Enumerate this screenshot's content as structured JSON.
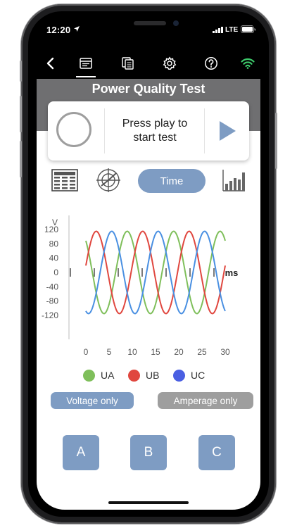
{
  "status_bar": {
    "time": "12:20",
    "network": "LTE"
  },
  "header": {
    "title": "Power Quality Test"
  },
  "test_card": {
    "message": "Press play to\nstart test"
  },
  "view_tabs": {
    "time_label": "Time"
  },
  "colors": {
    "accent": "#7e9cc3",
    "phase_a": "#7fbf5b",
    "phase_b": "#e0473f",
    "phase_c": "#4a90e2",
    "inactive": "#9e9e9e"
  },
  "chart_data": {
    "type": "line",
    "ylabel": "V",
    "xlabel": "ms",
    "x_ticks": [
      0,
      5,
      10,
      15,
      20,
      25,
      30
    ],
    "y_ticks": [
      120,
      80,
      40,
      0,
      -40,
      -80,
      -120
    ],
    "xlim": [
      0,
      30
    ],
    "ylim": [
      -120,
      120
    ],
    "series": [
      {
        "name": "UA",
        "amplitude": 115,
        "phase_deg": 0,
        "period_ms": 10
      },
      {
        "name": "UB",
        "amplitude": 115,
        "phase_deg": 120,
        "period_ms": 10
      },
      {
        "name": "UC",
        "amplitude": 115,
        "phase_deg": 240,
        "period_ms": 10
      }
    ]
  },
  "legend": [
    {
      "label": "UA",
      "color": "#7fbf5b"
    },
    {
      "label": "UB",
      "color": "#e0473f"
    },
    {
      "label": "UC",
      "color": "#4a90e2"
    }
  ],
  "filters": {
    "voltage_label": "Voltage only",
    "amperage_label": "Amperage only"
  },
  "phase_buttons": [
    "A",
    "B",
    "C"
  ]
}
